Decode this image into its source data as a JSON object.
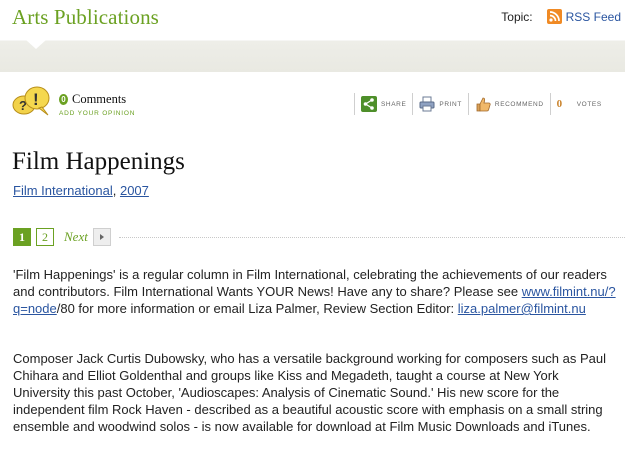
{
  "header": {
    "site_title": "Arts Publications",
    "topic_label": "Topic:",
    "rss_label": "RSS Feed",
    "rss_icon": "rss-icon"
  },
  "toolbar": {
    "comment_count": "0",
    "comments_label": "Comments",
    "add_opinion": "ADD YOUR OPINION",
    "share": "SHARE",
    "print": "PRINT",
    "recommend": "RECOMMEND",
    "votes_count": "0",
    "votes": "VOTES"
  },
  "article": {
    "title": "Film Happenings",
    "source": "Film International",
    "separator": ",",
    "year": "2007",
    "pager": {
      "pages": [
        "1",
        "2"
      ],
      "current": "1",
      "next_label": "Next"
    },
    "para1": {
      "text_a": "'Film Happenings' is a regular column in Film International, celebrating the achievements of our readers and contributors. Film International Wants YOUR News! Have any to share? Please see ",
      "link1": "www.filmint.nu/?q=node",
      "text_b": "/80 for more information or email Liza Palmer, Review Section Editor: ",
      "link2": "liza.palmer@filmint.nu"
    },
    "para2": "Composer Jack Curtis Dubowsky, who has a versatile background working for composers such as Paul Chihara and Elliot Goldenthal and groups like Kiss and Megadeth, taught a course at New York University this past October, 'Audioscapes: Analysis of Cinematic Sound.' His new score for the independent film Rock Haven - described as a beautiful acoustic score with emphasis on a small string ensemble and woodwind solos - is now available for download at Film Music Downloads and iTunes."
  },
  "colors": {
    "accent_green": "#6ba122",
    "link_blue": "#2a55a0",
    "rss_orange": "#f08a24"
  }
}
